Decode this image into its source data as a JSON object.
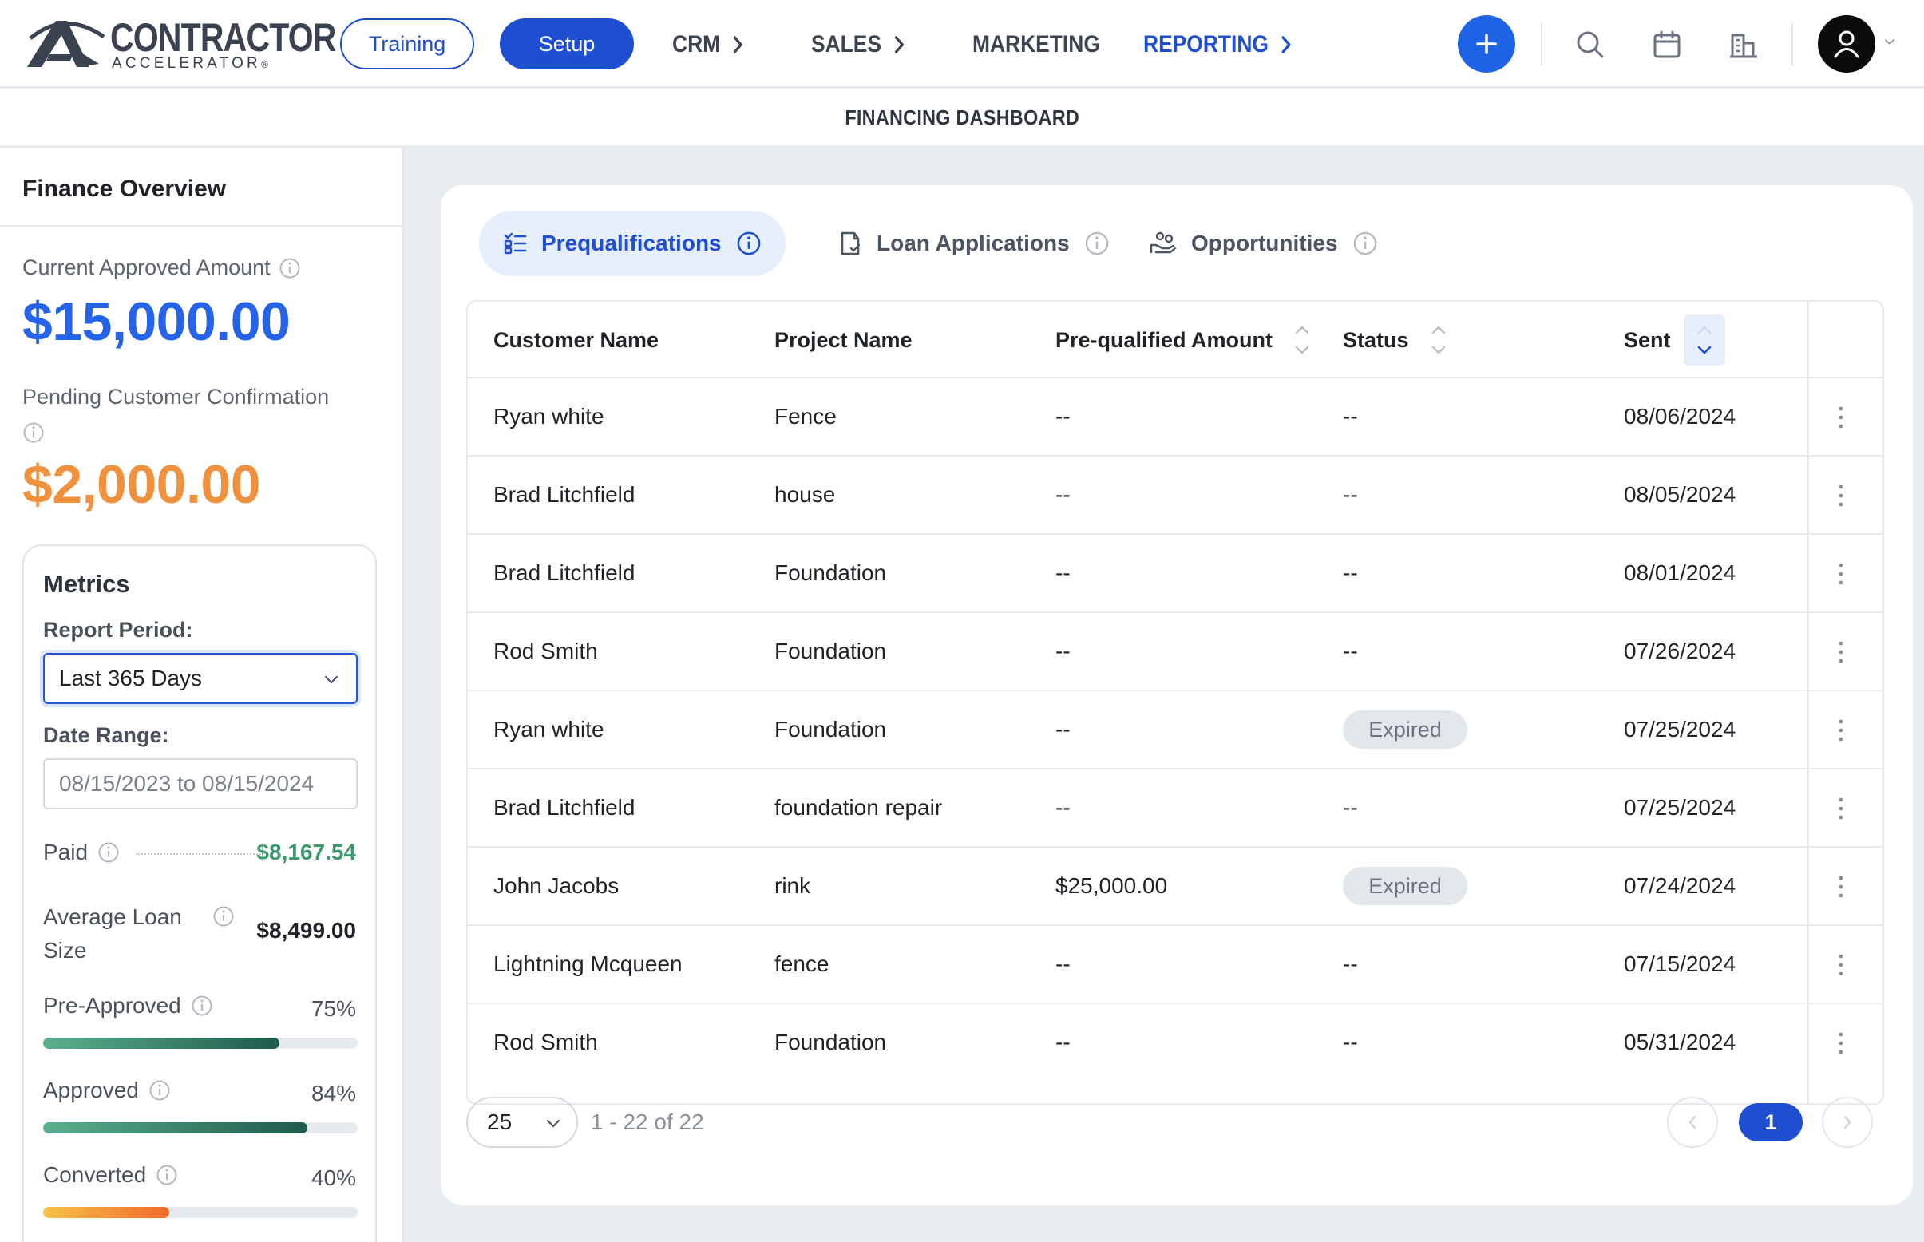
{
  "brand": {
    "logo_line1": "CONTRACTOR",
    "logo_line2": "ACCELERATOR",
    "logo_reg": "®"
  },
  "topnav": {
    "training_label": "Training",
    "setup_label": "Setup",
    "items": [
      {
        "label": "CRM",
        "has_chevron": true
      },
      {
        "label": "SALES",
        "has_chevron": true
      },
      {
        "label": "MARKETING",
        "has_chevron": false
      },
      {
        "label": "REPORTING",
        "has_chevron": true,
        "active": true
      }
    ],
    "icons": [
      "plus-icon",
      "search-icon",
      "calendar-icon",
      "building-icon",
      "user-icon"
    ]
  },
  "subheader": {
    "title": "FINANCING DASHBOARD"
  },
  "sidebar": {
    "title": "Finance Overview",
    "current_approved_label": "Current Approved Amount",
    "current_approved_value": "$15,000.00",
    "pending_label": "Pending Customer Confirmation",
    "pending_value": "$2,000.00",
    "metrics": {
      "title": "Metrics",
      "report_period_label": "Report Period:",
      "report_period_value": "Last 365 Days",
      "date_range_label": "Date Range:",
      "date_range_value": "08/15/2023 to 08/15/2024",
      "paid_label": "Paid",
      "paid_value": "$8,167.54",
      "avg_loan_label_1": "Average Loan",
      "avg_loan_label_2": "Size",
      "avg_loan_value": "$8,499.00",
      "rates": [
        {
          "label": "Pre-Approved",
          "value": "75%",
          "fraction": 0.75,
          "color": "green"
        },
        {
          "label": "Approved",
          "value": "84%",
          "fraction": 0.84,
          "color": "green"
        },
        {
          "label": "Converted",
          "value": "40%",
          "fraction": 0.4,
          "color": "orange"
        }
      ]
    }
  },
  "tabs": [
    {
      "label": "Prequalifications",
      "icon": "list-icon",
      "active": true
    },
    {
      "label": "Loan Applications",
      "icon": "document-icon",
      "active": false
    },
    {
      "label": "Opportunities",
      "icon": "hand-coins-icon",
      "active": false
    }
  ],
  "table": {
    "headers": {
      "customer": "Customer Name",
      "project": "Project Name",
      "amount": "Pre-qualified Amount",
      "status": "Status",
      "sent": "Sent"
    },
    "rows": [
      {
        "customer": "Ryan white",
        "project": "Fence",
        "amount": "--",
        "status": "--",
        "sent": "08/06/2024"
      },
      {
        "customer": "Brad Litchfield",
        "project": "house",
        "amount": "--",
        "status": "--",
        "sent": "08/05/2024"
      },
      {
        "customer": "Brad Litchfield",
        "project": "Foundation",
        "amount": "--",
        "status": "--",
        "sent": "08/01/2024"
      },
      {
        "customer": "Rod Smith",
        "project": "Foundation",
        "amount": "--",
        "status": "--",
        "sent": "07/26/2024"
      },
      {
        "customer": "Ryan white",
        "project": "Foundation",
        "amount": "--",
        "status": "Expired",
        "sent": "07/25/2024"
      },
      {
        "customer": "Brad Litchfield",
        "project": "foundation repair",
        "amount": "--",
        "status": "--",
        "sent": "07/25/2024"
      },
      {
        "customer": "John Jacobs",
        "project": "rink",
        "amount": "$25,000.00",
        "status": "Expired",
        "sent": "07/24/2024"
      },
      {
        "customer": "Lightning Mcqueen",
        "project": "fence",
        "amount": "--",
        "status": "--",
        "sent": "07/15/2024"
      },
      {
        "customer": "Rod Smith",
        "project": "Foundation",
        "amount": "--",
        "status": "--",
        "sent": "05/31/2024"
      }
    ]
  },
  "pagination": {
    "per_page": "25",
    "range_text": "1 - 22 of 22",
    "current_page": "1"
  },
  "colors": {
    "primary": "#1f4fd1",
    "approved_amount": "#2563eb",
    "pending_amount": "#f0913e",
    "paid_value": "#3e9a6c"
  }
}
